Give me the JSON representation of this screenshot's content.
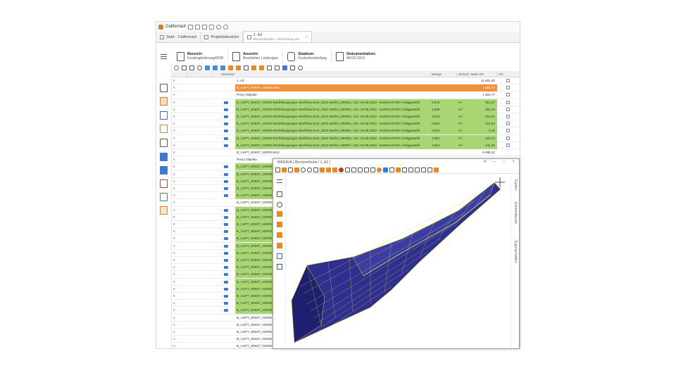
{
  "app": {
    "title": "CaliforniaX",
    "tabs": [
      {
        "label": "Start - CaliforniaX"
      },
      {
        "label": "Projektübersicht"
      },
      {
        "label": "1. AZ",
        "sub": "Blockmethode + Abrechnung mit"
      }
    ]
  },
  "ribbon": [
    {
      "title": "Bereich:",
      "value": "Kostengliederung/RGB"
    },
    {
      "title": "Ansicht:",
      "value": "Bearbeiten Leistungen"
    },
    {
      "title": "Stadium:",
      "value": "Kostenfeststellung"
    },
    {
      "title": "Dokumentation:",
      "value": "AKVS 2014"
    }
  ],
  "grid": {
    "columns": [
      "Stichwort",
      "Menge",
      "Einheit",
      "Netto-GP",
      "OK"
    ],
    "rows": [
      {
        "kind": "plain",
        "text": "1. AZ",
        "menge": "",
        "einheit": "",
        "gp": "11.691,40"
      },
      {
        "kind": "orange",
        "text": "B_AUFT_WW27_NORD.Wn2",
        "menge": "",
        "einheit": "",
        "gp": "1.363,77"
      },
      {
        "kind": "plain",
        "text": "Proxy Objekte",
        "menge": "",
        "einheit": "",
        "gp": "1.363,77"
      },
      {
        "kind": "green",
        "text": "B_AUFT_WW27_NORD.Würfelbaugruppe.Würfelhorizont_0322.Würfel_000001, AZ1: 04.08.2022 - 54250-547500, fertiggestellt",
        "menge": "0,575",
        "einheit": "m³",
        "gp": "314,27"
      },
      {
        "kind": "green",
        "text": "B_AUFT_WW27_NORD.Würfelbaugruppe.Würfelhorizont_0322.Würfel_000002, AZ1: 04.08.2022 - 54250-547500, fertiggestellt",
        "menge": "0,889",
        "einheit": "m³",
        "gp": "362,43"
      },
      {
        "kind": "green",
        "text": "B_AUFT_WW27_NORD.Würfelbaugruppe.Würfelhorizont_0322.Würfel_000003, AZ1: 04.08.2022 - 54250-547500, fertiggestellt",
        "menge": "0,628",
        "einheit": "m³",
        "gp": "316,22"
      },
      {
        "kind": "green",
        "text": "B_AUFT_WW27_NORD.Würfelbaugruppe.Würfelhorizont_0322.Würfel_000004, AZ1: 04.08.2022 - 54250-547500, fertiggestellt",
        "menge": "0,694",
        "einheit": "m³",
        "gp": "318,84"
      },
      {
        "kind": "green",
        "text": "B_AUFT_WW27_NORD.Würfelbaugruppe.Würfelhorizont_0322.Würfel_000005, AZ1: 04.08.2022 - 54250-547500, fertiggestellt",
        "menge": "0,004",
        "einheit": "m³",
        "gp": "0,15"
      },
      {
        "kind": "green",
        "text": "B_AUFT_WW27_NORD.Würfelbaugruppe.Würfelhorizont_0322.Würfel_000006, AZ1: 04.08.2022 - 54250-547500, fertiggestellt",
        "menge": "3,067",
        "einheit": "m³",
        "gp": "119,74"
      },
      {
        "kind": "green",
        "text": "B_AUFT_WW27_NORD.Würfelbaugruppe.Würfelhorizont_0322.Würfel_000007, AZ1: 04.08.2022 - 54250-547500, fertiggestellt",
        "menge": "3,561",
        "einheit": "m³",
        "gp": "131,32"
      },
      {
        "kind": "plain",
        "text": "B_AUFT_WW27_NORD.Wn2",
        "menge": "",
        "einheit": "",
        "gp": "8.495,22"
      },
      {
        "kind": "plain",
        "text": "Proxy Objekte",
        "menge": "",
        "einheit": "",
        "gp": ""
      },
      {
        "kind": "green",
        "text": "B_AUFT_WW27_NORD.Würfelba",
        "menge": "",
        "einheit": "",
        "gp": ""
      },
      {
        "kind": "green",
        "text": "B_AUFT_WW27_NORD.Würfelba",
        "menge": "",
        "einheit": "",
        "gp": ""
      },
      {
        "kind": "green",
        "text": "B_AUFT_WW27_NORD.Würfelba",
        "menge": "",
        "einheit": "",
        "gp": ""
      },
      {
        "kind": "green",
        "text": "B_AUFT_WW27_NORD.Würfelba",
        "menge": "",
        "einheit": "",
        "gp": ""
      },
      {
        "kind": "green",
        "text": "B_AUFT_WW27_NORD.Würfelba",
        "menge": "",
        "einheit": "",
        "gp": ""
      },
      {
        "kind": "plain",
        "text": "B_AUFT_WW27_NORD.Würfelba",
        "menge": "",
        "einheit": "",
        "gp": ""
      },
      {
        "kind": "green",
        "text": "B_AUFT_WW27_NORD.Würfelba",
        "menge": "",
        "einheit": "",
        "gp": ""
      },
      {
        "kind": "green",
        "text": "B_AUFT_WW27_NORD.Würfelba",
        "menge": "",
        "einheit": "",
        "gp": ""
      },
      {
        "kind": "green",
        "text": "B_AUFT_WW27_NORD.Würfelba",
        "menge": "",
        "einheit": "",
        "gp": ""
      },
      {
        "kind": "green",
        "text": "B_AUFT_WW27_NORD.Würfelba",
        "menge": "",
        "einheit": "",
        "gp": ""
      },
      {
        "kind": "green",
        "text": "B_AUFT_WW27_NORD.Würfelba",
        "menge": "",
        "einheit": "",
        "gp": ""
      },
      {
        "kind": "green",
        "text": "B_AUFT_WW27_NORD.Würfelba",
        "menge": "",
        "einheit": "",
        "gp": ""
      },
      {
        "kind": "green",
        "text": "B_AUFT_WW27_NORD.Würfelba",
        "menge": "",
        "einheit": "",
        "gp": ""
      },
      {
        "kind": "green",
        "text": "B_AUFT_WW27_NORD.Würfelba",
        "menge": "",
        "einheit": "",
        "gp": ""
      },
      {
        "kind": "green",
        "text": "B_AUFT_WW27_NORD.Würfelba",
        "menge": "",
        "einheit": "",
        "gp": ""
      },
      {
        "kind": "green",
        "text": "B_AUFT_WW27_NORD.Würfelba",
        "menge": "",
        "einheit": "",
        "gp": ""
      },
      {
        "kind": "green",
        "text": "B_AUFT_WW27_NORD.Würfelba",
        "menge": "",
        "einheit": "",
        "gp": ""
      },
      {
        "kind": "green",
        "text": "B_AUFT_WW27_NORD.Würfelba",
        "menge": "",
        "einheit": "",
        "gp": ""
      },
      {
        "kind": "green",
        "text": "B_AUFT_WW27_NORD.Würfelba",
        "menge": "",
        "einheit": "",
        "gp": ""
      },
      {
        "kind": "green",
        "text": "B_AUFT_WW27_NORD.Würfelba",
        "menge": "",
        "einheit": "",
        "gp": ""
      },
      {
        "kind": "green",
        "text": "B_AUFT_WW27_NORD.Würfelba",
        "menge": "",
        "einheit": "",
        "gp": ""
      },
      {
        "kind": "plain",
        "text": "B_AUFT_WW27_NORD.Würfelba",
        "menge": "",
        "einheit": "",
        "gp": ""
      },
      {
        "kind": "plain",
        "text": "B_AUFT_WW27_NORD.Würfelba",
        "menge": "",
        "einheit": "",
        "gp": ""
      },
      {
        "kind": "plain",
        "text": "B_AUFT_WW27_NORD.Würfelba",
        "menge": "",
        "einheit": "",
        "gp": ""
      },
      {
        "kind": "plain",
        "text": "B_AUFT_WW27_NORD.Würfelba",
        "menge": "",
        "einheit": "",
        "gp": ""
      },
      {
        "kind": "plain",
        "text": "B_AUFT_WW27_NORD.Würfelbaugruppe.Würfelhorizont_0322.Würfel_000023",
        "menge": "",
        "einheit": "",
        "gp": ""
      }
    ]
  },
  "viewer": {
    "title": "BIM2AVA  [ Blockmethode /  1. AZ ]",
    "side_tabs": [
      "Farben",
      "Elementbaum",
      "Eigenschaften"
    ]
  },
  "colors": {
    "accent_orange": "#f1913a",
    "row_green": "#a8d672",
    "mesh_blue": "#2e2f8f",
    "mesh_yellow": "#d8d84a"
  }
}
